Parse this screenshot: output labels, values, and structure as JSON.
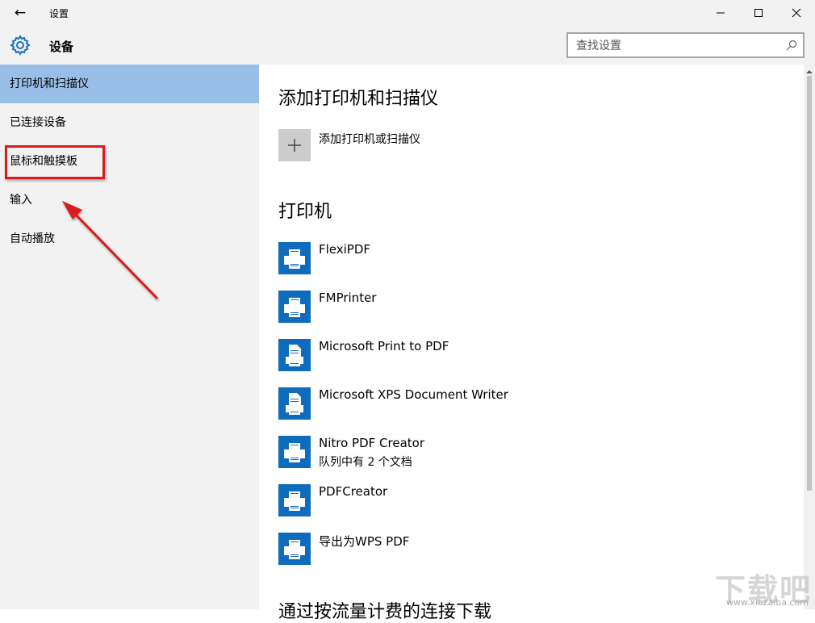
{
  "window": {
    "title": "设置",
    "back_icon": "back-arrow-icon",
    "controls": [
      "minimize-icon",
      "maximize-icon",
      "close-icon"
    ]
  },
  "header": {
    "icon": "gear-icon",
    "title": "设备"
  },
  "search": {
    "placeholder": "查找设置",
    "icon": "search-icon"
  },
  "sidebar": {
    "items": [
      {
        "label": "打印机和扫描仪",
        "selected": true
      },
      {
        "label": "已连接设备",
        "selected": false
      },
      {
        "label": "鼠标和触摸板",
        "selected": false
      },
      {
        "label": "输入",
        "selected": false
      },
      {
        "label": "自动播放",
        "selected": false
      }
    ]
  },
  "main": {
    "add_section_title": "添加打印机和扫描仪",
    "add_button_label": "添加打印机或扫描仪",
    "printers_section_title": "打印机",
    "printers": [
      {
        "name": "FlexiPDF",
        "status": "",
        "icon": "printer-icon"
      },
      {
        "name": "FMPrinter",
        "status": "",
        "icon": "printer-icon"
      },
      {
        "name": "Microsoft Print to PDF",
        "status": "",
        "icon": "document-printer-icon"
      },
      {
        "name": "Microsoft XPS Document Writer",
        "status": "",
        "icon": "document-printer-icon"
      },
      {
        "name": "Nitro PDF Creator",
        "status": "队列中有 2 个文档",
        "icon": "printer-icon"
      },
      {
        "name": "PDFCreator",
        "status": "",
        "icon": "printer-icon"
      },
      {
        "name": "导出为WPS PDF",
        "status": "",
        "icon": "printer-icon"
      }
    ],
    "next_section_title_partial": "通过按流量计费的连接下载"
  },
  "watermark": {
    "text": "下载吧",
    "url": "www.xiazaiba.com"
  },
  "colors": {
    "accent": "#0f6cbd",
    "selected_bg": "#99bfe8",
    "sidebar_bg": "#f2f2f2",
    "annotation_red": "#d81b1b"
  }
}
